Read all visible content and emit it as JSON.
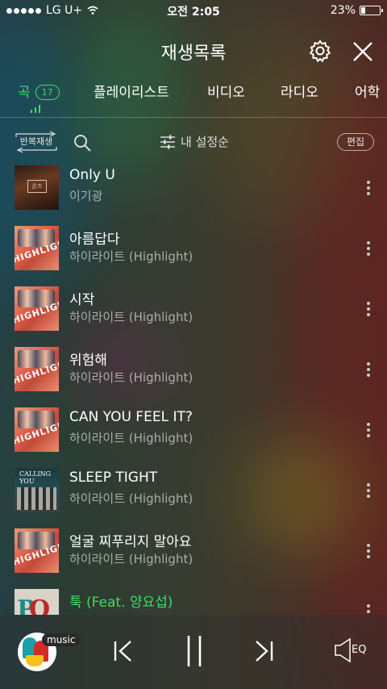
{
  "status_bar": {
    "carrier": "LG U+",
    "time": "오전 2:05",
    "battery": "23%",
    "battery_level": 0.23
  },
  "header": {
    "title": "재생목록"
  },
  "tabs": [
    {
      "label": "곡",
      "count": "17",
      "active": true
    },
    {
      "label": "플레이리스트"
    },
    {
      "label": "비디오"
    },
    {
      "label": "라디오"
    },
    {
      "label": "어학"
    }
  ],
  "toolbar": {
    "repeat_label": "반복재생",
    "sort_label": "내 설정순",
    "edit_label": "편집"
  },
  "songs": [
    {
      "title": "Only U",
      "artist": "이기광",
      "art": "iu"
    },
    {
      "title": "아름답다",
      "artist": "하이라이트 (Highlight)",
      "art": "highlight"
    },
    {
      "title": "시작",
      "artist": "하이라이트 (Highlight)",
      "art": "highlight"
    },
    {
      "title": "위험해",
      "artist": "하이라이트 (Highlight)",
      "art": "highlight"
    },
    {
      "title": "CAN YOU FEEL IT?",
      "artist": "하이라이트 (Highlight)",
      "art": "highlight"
    },
    {
      "title": "SLEEP TIGHT",
      "artist": "하이라이트 (Highlight)",
      "art": "calling_you"
    },
    {
      "title": "얼굴 찌푸리지 말아요",
      "artist": "하이라이트 (Highlight)",
      "art": "highlight"
    },
    {
      "title": "툭 (Feat. 양요섭)",
      "artist": "",
      "art": "pop",
      "playing": true
    }
  ],
  "album_art_text": {
    "only_u_box": "온즈",
    "highlight": "HIGHLIGHT",
    "calling_you": "CALLING YOU",
    "pop": "POP"
  },
  "player": {
    "app_label": "music",
    "eq_label": "EQ"
  },
  "colors": {
    "accent": "#3ddc66",
    "text_primary": "#ffffff",
    "text_secondary": "#b0b0b0"
  },
  "icons": [
    "settings-gear-icon",
    "close-icon",
    "search-icon",
    "sort-sliders-icon",
    "more-vertical-icon",
    "previous-icon",
    "pause-icon",
    "next-icon",
    "equalizer-icon",
    "repeat-icon"
  ]
}
